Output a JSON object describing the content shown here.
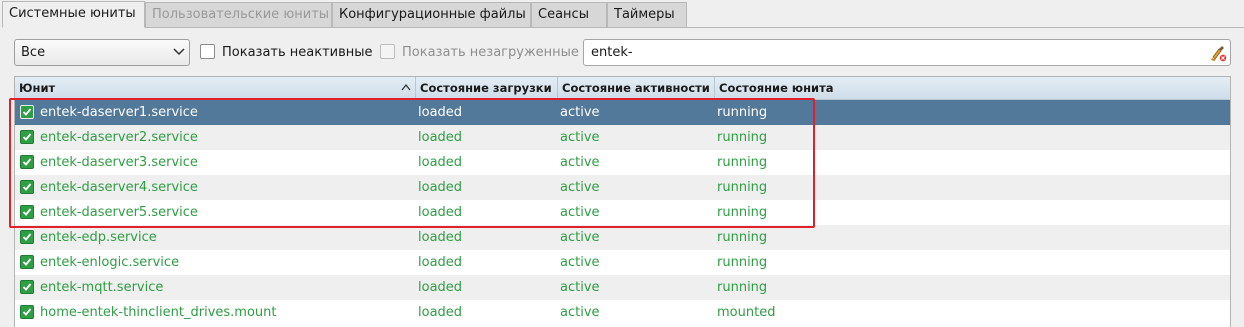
{
  "tabs": [
    {
      "label": "Системные юниты",
      "state": "active"
    },
    {
      "label": "Пользовательские юниты",
      "state": "disabled"
    },
    {
      "label": "Конфигурационные файлы",
      "state": "normal"
    },
    {
      "label": "Сеансы",
      "state": "normal"
    },
    {
      "label": "Таймеры",
      "state": "normal"
    }
  ],
  "filter": {
    "combo_value": "Все",
    "show_inactive_label": "Показать неактивные",
    "show_unloaded_label": "Показать незагруженные",
    "search_value": "entek-"
  },
  "table": {
    "columns": [
      "Юнит",
      "Состояние загрузки",
      "Состояние активности",
      "Состояние юнита"
    ],
    "rows": [
      {
        "unit": "entek-daserver1.service",
        "load": "loaded",
        "active": "active",
        "sub": "running",
        "selected": true
      },
      {
        "unit": "entek-daserver2.service",
        "load": "loaded",
        "active": "active",
        "sub": "running"
      },
      {
        "unit": "entek-daserver3.service",
        "load": "loaded",
        "active": "active",
        "sub": "running"
      },
      {
        "unit": "entek-daserver4.service",
        "load": "loaded",
        "active": "active",
        "sub": "running"
      },
      {
        "unit": "entek-daserver5.service",
        "load": "loaded",
        "active": "active",
        "sub": "running"
      },
      {
        "unit": "entek-edp.service",
        "load": "loaded",
        "active": "active",
        "sub": "running"
      },
      {
        "unit": "entek-enlogic.service",
        "load": "loaded",
        "active": "active",
        "sub": "running"
      },
      {
        "unit": "entek-mqtt.service",
        "load": "loaded",
        "active": "active",
        "sub": "running"
      },
      {
        "unit": "home-entek-thinclient_drives.mount",
        "load": "loaded",
        "active": "active",
        "sub": "mounted"
      }
    ]
  },
  "colors": {
    "active_text": "#2f9e44",
    "selection": "#53799a",
    "highlight_box": "#e0202a"
  }
}
